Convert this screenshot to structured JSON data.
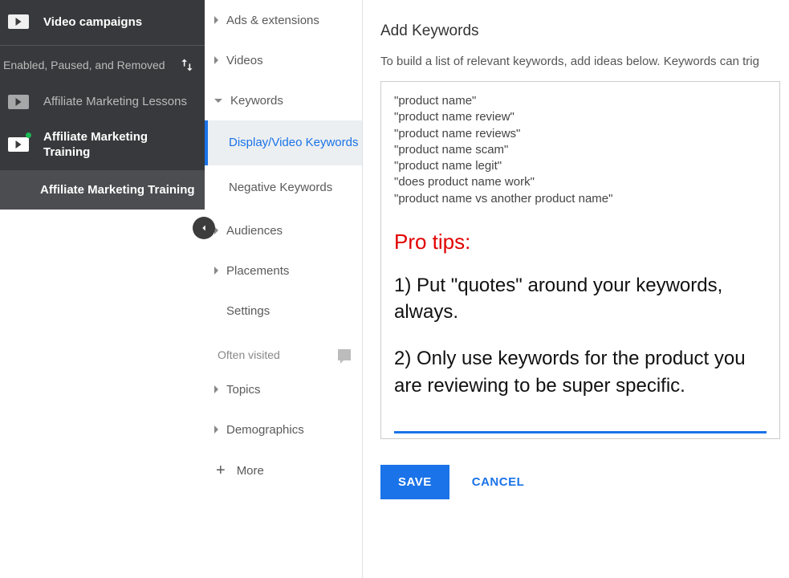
{
  "sidebar": {
    "title": "Video campaigns",
    "filter_label": "Enabled, Paused, and Removed",
    "campaigns": [
      {
        "label": "Affiliate Marketing Lessons",
        "active": false
      },
      {
        "label": "Affiliate Marketing Training",
        "active": true
      }
    ],
    "sub_campaign": "Affiliate Marketing Training"
  },
  "midnav": {
    "items": {
      "ads_ext": "Ads & extensions",
      "videos": "Videos",
      "keywords": "Keywords",
      "display_video_keywords": "Display/Video Keywords",
      "negative_keywords": "Negative Keywords",
      "audiences": "Audiences",
      "placements": "Placements",
      "settings": "Settings",
      "often_visited": "Often visited",
      "topics": "Topics",
      "demographics": "Demographics",
      "more": "More"
    }
  },
  "main": {
    "heading": "Add Keywords",
    "subtext": "To build a list of relevant keywords, add ideas below. Keywords can trig",
    "keywords": [
      "\"product name\"",
      "\"product name review\"",
      "\"product name reviews\"",
      "\"product name scam\"",
      "\"product name legit\"",
      "\"does product name work\"",
      "\"product name vs another product name\""
    ],
    "pro_heading": "Pro tips:",
    "pro_tip_1": "1) Put \"quotes\" around your keywords, always.",
    "pro_tip_2": "2) Only use keywords for the product you are reviewing to be super specific.",
    "save_label": "SAVE",
    "cancel_label": "CANCEL"
  }
}
